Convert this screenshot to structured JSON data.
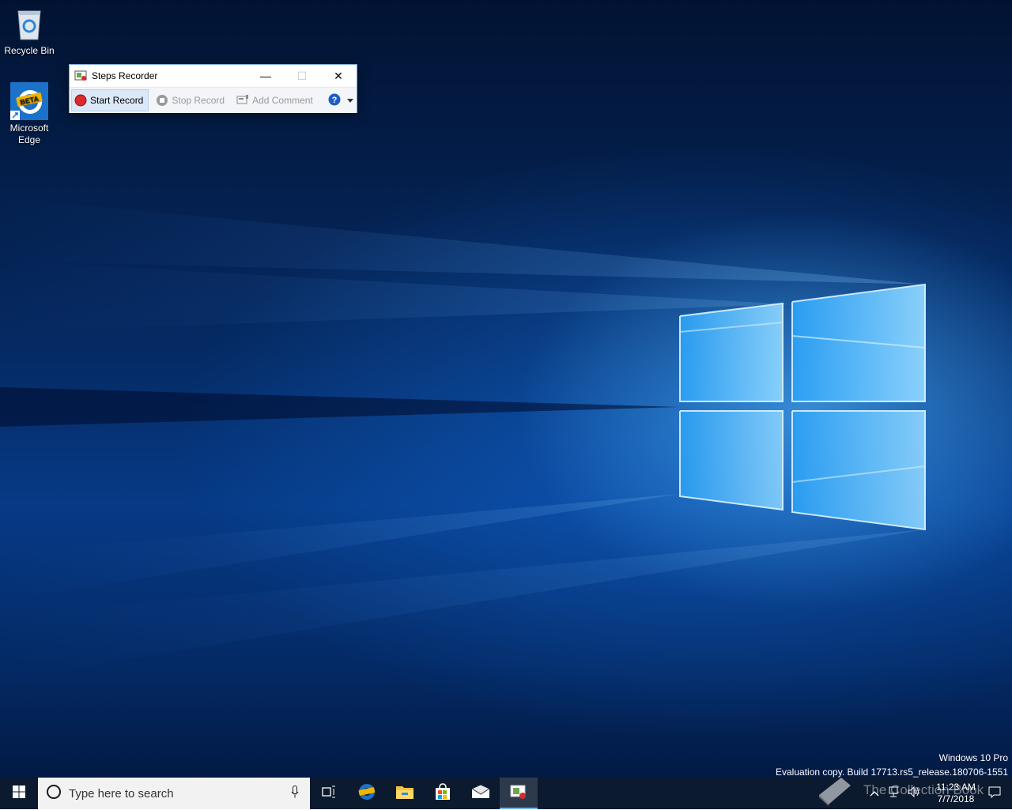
{
  "desktop": {
    "icons": [
      {
        "label": "Recycle Bin",
        "icon": "recycle-bin-icon"
      },
      {
        "label": "Microsoft Edge",
        "icon": "edge-beta-icon",
        "badge": "BETA"
      }
    ]
  },
  "steps_recorder": {
    "title": "Steps Recorder",
    "toolbar": {
      "start_record": "Start Record",
      "stop_record": "Stop Record",
      "add_comment": "Add Comment"
    },
    "caption": {
      "minimize": "—",
      "maximize": "☐",
      "close": "✕"
    }
  },
  "watermark": {
    "edition": "Windows 10 Pro",
    "build": "Evaluation copy. Build 17713.rs5_release.180706-1551"
  },
  "taskbar": {
    "search_placeholder": "Type here to search",
    "pinned": [
      "task-view-icon",
      "edge-beta-icon",
      "file-explorer-icon",
      "store-icon",
      "mail-icon",
      "steps-recorder-icon"
    ],
    "clock": {
      "time": "11:23 AM",
      "date": "7/7/2018"
    }
  },
  "overlay_brand": "The Collection Book",
  "colors": {
    "accent": "#76b9ed",
    "record_red": "#d92b2b",
    "taskbar_bg": "#0b1a2e"
  }
}
